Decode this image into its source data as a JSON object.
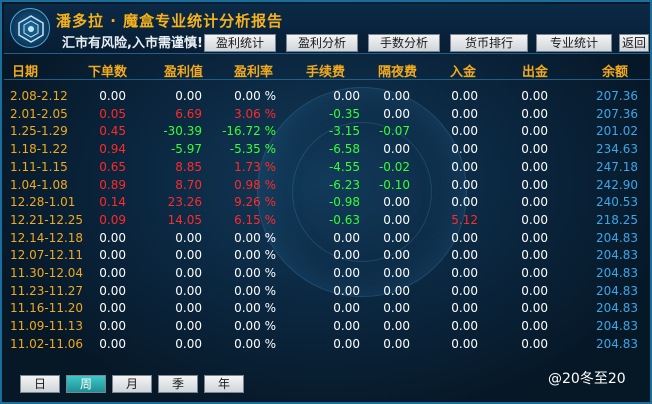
{
  "header": {
    "title": "潘多拉 · 魔盒专业统计分析报告",
    "subtitle": "汇市有风险,入市需谨慎!",
    "nav": [
      "盈利统计",
      "盈利分析",
      "手数分析",
      "货币排行",
      "专业统计"
    ],
    "back_label": "返回"
  },
  "columns": [
    "日期",
    "下单数",
    "盈利值",
    "盈利率",
    "手续费",
    "隔夜费",
    "入金",
    "出金",
    "余额"
  ],
  "rows": [
    {
      "date": "2.08-2.12",
      "orders": "0.00",
      "profit": "0.00",
      "rate": "0.00 %",
      "fee": "0.00",
      "swap": "0.00",
      "deposit": "0.00",
      "withdraw": "0.00",
      "balance": "207.36",
      "o": "white",
      "p": "white",
      "r": "white",
      "f": "white",
      "s": "white",
      "d": "white"
    },
    {
      "date": "2.01-2.05",
      "orders": "0.05",
      "profit": "6.69",
      "rate": "3.06 %",
      "fee": "-0.35",
      "swap": "0.00",
      "deposit": "0.00",
      "withdraw": "0.00",
      "balance": "207.36",
      "o": "red",
      "p": "red",
      "r": "red",
      "f": "green",
      "s": "white",
      "d": "white"
    },
    {
      "date": "1.25-1.29",
      "orders": "0.45",
      "profit": "-30.39",
      "rate": "-16.72 %",
      "fee": "-3.15",
      "swap": "-0.07",
      "deposit": "0.00",
      "withdraw": "0.00",
      "balance": "201.02",
      "o": "red",
      "p": "green",
      "r": "green",
      "f": "green",
      "s": "green",
      "d": "white"
    },
    {
      "date": "1.18-1.22",
      "orders": "0.94",
      "profit": "-5.97",
      "rate": "-5.35 %",
      "fee": "-6.58",
      "swap": "0.00",
      "deposit": "0.00",
      "withdraw": "0.00",
      "balance": "234.63",
      "o": "red",
      "p": "green",
      "r": "green",
      "f": "green",
      "s": "white",
      "d": "white"
    },
    {
      "date": "1.11-1.15",
      "orders": "0.65",
      "profit": "8.85",
      "rate": "1.73 %",
      "fee": "-4.55",
      "swap": "-0.02",
      "deposit": "0.00",
      "withdraw": "0.00",
      "balance": "247.18",
      "o": "red",
      "p": "red",
      "r": "red",
      "f": "green",
      "s": "green",
      "d": "white"
    },
    {
      "date": "1.04-1.08",
      "orders": "0.89",
      "profit": "8.70",
      "rate": "0.98 %",
      "fee": "-6.23",
      "swap": "-0.10",
      "deposit": "0.00",
      "withdraw": "0.00",
      "balance": "242.90",
      "o": "red",
      "p": "red",
      "r": "red",
      "f": "green",
      "s": "green",
      "d": "white"
    },
    {
      "date": "12.28-1.01",
      "orders": "0.14",
      "profit": "23.26",
      "rate": "9.26 %",
      "fee": "-0.98",
      "swap": "0.00",
      "deposit": "0.00",
      "withdraw": "0.00",
      "balance": "240.53",
      "o": "red",
      "p": "red",
      "r": "red",
      "f": "green",
      "s": "white",
      "d": "white"
    },
    {
      "date": "12.21-12.25",
      "orders": "0.09",
      "profit": "14.05",
      "rate": "6.15 %",
      "fee": "-0.63",
      "swap": "0.00",
      "deposit": "5.12",
      "withdraw": "0.00",
      "balance": "218.25",
      "o": "red",
      "p": "red",
      "r": "red",
      "f": "green",
      "s": "white",
      "d": "red"
    },
    {
      "date": "12.14-12.18",
      "orders": "0.00",
      "profit": "0.00",
      "rate": "0.00 %",
      "fee": "0.00",
      "swap": "0.00",
      "deposit": "0.00",
      "withdraw": "0.00",
      "balance": "204.83",
      "o": "white",
      "p": "white",
      "r": "white",
      "f": "white",
      "s": "white",
      "d": "white"
    },
    {
      "date": "12.07-12.11",
      "orders": "0.00",
      "profit": "0.00",
      "rate": "0.00 %",
      "fee": "0.00",
      "swap": "0.00",
      "deposit": "0.00",
      "withdraw": "0.00",
      "balance": "204.83",
      "o": "white",
      "p": "white",
      "r": "white",
      "f": "white",
      "s": "white",
      "d": "white"
    },
    {
      "date": "11.30-12.04",
      "orders": "0.00",
      "profit": "0.00",
      "rate": "0.00 %",
      "fee": "0.00",
      "swap": "0.00",
      "deposit": "0.00",
      "withdraw": "0.00",
      "balance": "204.83",
      "o": "white",
      "p": "white",
      "r": "white",
      "f": "white",
      "s": "white",
      "d": "white"
    },
    {
      "date": "11.23-11.27",
      "orders": "0.00",
      "profit": "0.00",
      "rate": "0.00 %",
      "fee": "0.00",
      "swap": "0.00",
      "deposit": "0.00",
      "withdraw": "0.00",
      "balance": "204.83",
      "o": "white",
      "p": "white",
      "r": "white",
      "f": "white",
      "s": "white",
      "d": "white"
    },
    {
      "date": "11.16-11.20",
      "orders": "0.00",
      "profit": "0.00",
      "rate": "0.00 %",
      "fee": "0.00",
      "swap": "0.00",
      "deposit": "0.00",
      "withdraw": "0.00",
      "balance": "204.83",
      "o": "white",
      "p": "white",
      "r": "white",
      "f": "white",
      "s": "white",
      "d": "white"
    },
    {
      "date": "11.09-11.13",
      "orders": "0.00",
      "profit": "0.00",
      "rate": "0.00 %",
      "fee": "0.00",
      "swap": "0.00",
      "deposit": "0.00",
      "withdraw": "0.00",
      "balance": "204.83",
      "o": "white",
      "p": "white",
      "r": "white",
      "f": "white",
      "s": "white",
      "d": "white"
    },
    {
      "date": "11.02-11.06",
      "orders": "0.00",
      "profit": "0.00",
      "rate": "0.00 %",
      "fee": "0.00",
      "swap": "0.00",
      "deposit": "0.00",
      "withdraw": "0.00",
      "balance": "204.83",
      "o": "white",
      "p": "white",
      "r": "white",
      "f": "white",
      "s": "white",
      "d": "white"
    }
  ],
  "periods": [
    "日",
    "周",
    "月",
    "季",
    "年"
  ],
  "active_period": "周",
  "watermark": "@20冬至20",
  "colors": {
    "accent": "#f2a91c",
    "balance": "#3aa7ea",
    "positive": "#ff2a2a",
    "negative": "#33ff33"
  }
}
